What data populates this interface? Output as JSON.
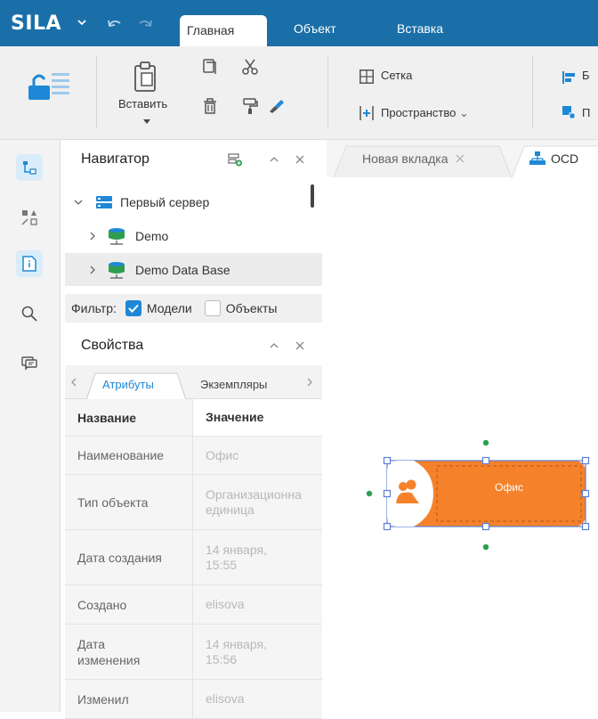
{
  "app": {
    "logo": "SILA"
  },
  "ribbon_tabs": [
    {
      "label": "Главная",
      "active": true
    },
    {
      "label": "Объект",
      "active": false
    },
    {
      "label": "Вставка",
      "active": false
    }
  ],
  "ribbon": {
    "paste_label": "Вставить",
    "grid_label": "Сетка",
    "space_label": "Пространство",
    "cut_right_1": "Б",
    "cut_right_2": "П"
  },
  "navigator": {
    "title": "Навигатор",
    "tree": [
      {
        "label": "Первый сервер",
        "level": 0,
        "expanded": true
      },
      {
        "label": "Demo",
        "level": 1,
        "expanded": false
      },
      {
        "label": "Demo Data Base",
        "level": 1,
        "expanded": false,
        "selected": true
      }
    ],
    "filter_label": "Фильтр:",
    "filter_models": {
      "label": "Модели",
      "checked": true
    },
    "filter_objects": {
      "label": "Объекты",
      "checked": false
    }
  },
  "properties": {
    "title": "Свойства",
    "tabs": [
      {
        "label": "Атрибуты",
        "active": true
      },
      {
        "label": "Экземпляры",
        "active": false
      }
    ],
    "col_name": "Название",
    "col_value": "Значение",
    "rows": [
      {
        "name": "Наименование",
        "value": "Офис"
      },
      {
        "name": "Тип объекта",
        "value": "Организационна единица"
      },
      {
        "name": "Дата создания",
        "value": "14 января, 15:55"
      },
      {
        "name": "Создано",
        "value": "elisova"
      },
      {
        "name": "Дата изменения",
        "value": "14 января, 15:56"
      },
      {
        "name": "Изменил",
        "value": "elisova"
      }
    ]
  },
  "canvas_tabs": [
    {
      "label": "Новая вкладка",
      "active": false
    },
    {
      "label": "OCD",
      "active": true
    }
  ],
  "diagram": {
    "object_label": "Офис",
    "object_color": "#f5822a",
    "selection_color": "#5b7fd6",
    "handle_color": "#2e9e4e"
  },
  "colors": {
    "titlebar": "#1a6fa8",
    "accent": "#1e88d6"
  }
}
